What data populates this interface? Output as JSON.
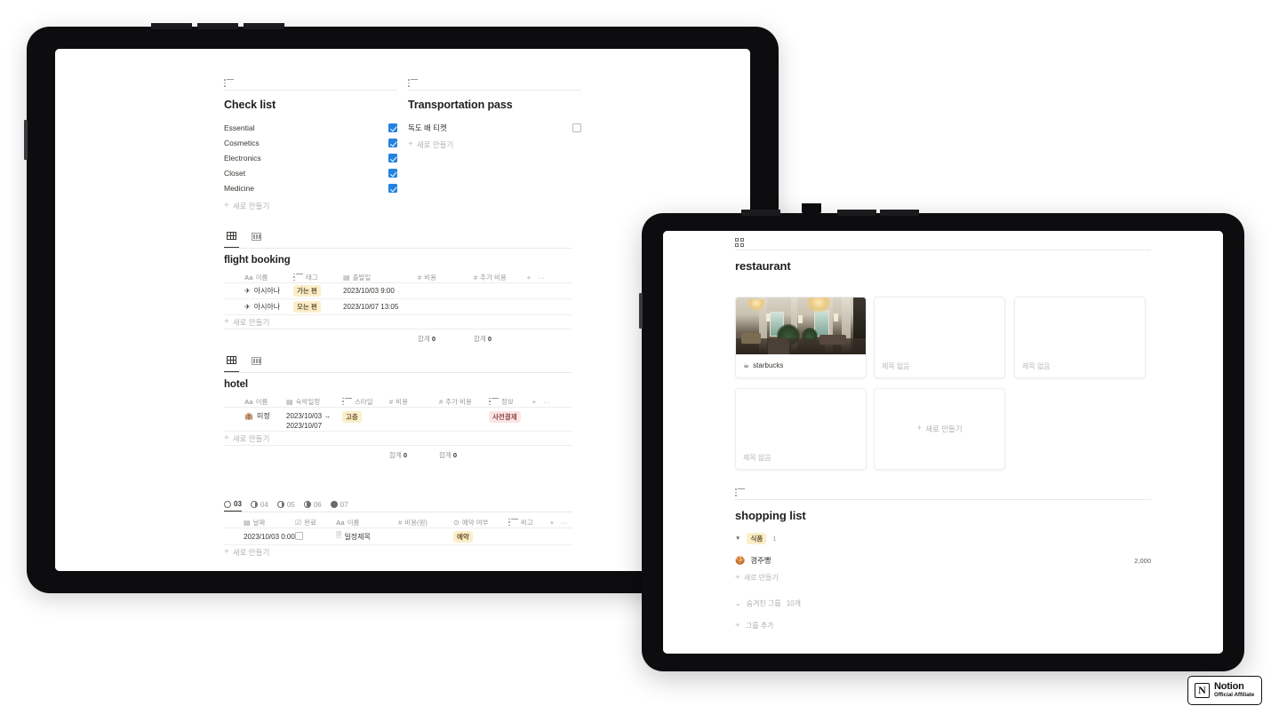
{
  "left_tablet": {
    "checklist": {
      "view_icon": "list-view-icon",
      "title": "Check list",
      "items": [
        {
          "label": "Essential",
          "checked": true
        },
        {
          "label": "Cosmetics",
          "checked": true
        },
        {
          "label": "Electronics",
          "checked": true
        },
        {
          "label": "Closet",
          "checked": true
        },
        {
          "label": "Medicine",
          "checked": true
        }
      ],
      "new_label": "새로 만들기"
    },
    "transportation": {
      "view_icon": "list-view-icon",
      "title": "Transportation pass",
      "items": [
        {
          "label": "독도 배 티켓",
          "checked": false
        }
      ],
      "new_label": "새로 만들기"
    },
    "flight_booking": {
      "tabs": [
        {
          "icon": "table-view-icon",
          "active": true
        },
        {
          "icon": "board-view-icon",
          "active": false
        }
      ],
      "title": "flight booking",
      "columns": [
        {
          "type": "Aa",
          "label": "이름"
        },
        {
          "type": "list",
          "label": "태그"
        },
        {
          "type": "date",
          "label": "출발일"
        },
        {
          "type": "#",
          "label": "비용"
        },
        {
          "type": "#",
          "label": "추가 비용"
        }
      ],
      "add_column": "+",
      "more": "···",
      "rows": [
        {
          "icon": "✈",
          "name": "아시아나",
          "tag": "가는 편",
          "tag_color": "#fbeeca",
          "date": "2023/10/03 9:00",
          "cost": "",
          "extra": ""
        },
        {
          "icon": "✈",
          "name": "아시아나",
          "tag": "오는 편",
          "tag_color": "#fbeeca",
          "date": "2023/10/07 13:05",
          "cost": "",
          "extra": ""
        }
      ],
      "new_label": "새로 만들기",
      "summaries": [
        {
          "label": "합계",
          "value": "0"
        },
        {
          "label": "합계",
          "value": "0"
        }
      ]
    },
    "hotel": {
      "tabs": [
        {
          "icon": "table-view-icon",
          "active": true
        },
        {
          "icon": "board-view-icon",
          "active": false
        }
      ],
      "title": "hotel",
      "columns": [
        {
          "type": "Aa",
          "label": "이름"
        },
        {
          "type": "date",
          "label": "숙박일정"
        },
        {
          "type": "list",
          "label": "스타일"
        },
        {
          "type": "#",
          "label": "비용"
        },
        {
          "type": "#",
          "label": "추가 비용"
        },
        {
          "type": "list",
          "label": "정보"
        }
      ],
      "add_column": "+",
      "more": "···",
      "rows": [
        {
          "icon": "🏨",
          "name": "미정",
          "date_line1": "2023/10/03 →",
          "date_line2": "2023/10/07",
          "style": "고층",
          "style_color": "#fbeeca",
          "cost": "",
          "extra": "",
          "info": "사전결제",
          "info_color": "#fbe4e4"
        }
      ],
      "new_label": "새로 만들기",
      "summaries": [
        {
          "label": "합계",
          "value": "0"
        },
        {
          "label": "합계",
          "value": "0"
        }
      ]
    },
    "schedule": {
      "day_tabs": [
        {
          "label": "03",
          "moon": "new",
          "active": true
        },
        {
          "label": "04",
          "moon": "waxing-crescent",
          "active": false
        },
        {
          "label": "05",
          "moon": "first-quarter",
          "active": false
        },
        {
          "label": "06",
          "moon": "waxing-gibbous",
          "active": false
        },
        {
          "label": "07",
          "moon": "full",
          "active": false
        }
      ],
      "columns": [
        {
          "type": "date",
          "label": "날짜"
        },
        {
          "type": "check",
          "label": "완료"
        },
        {
          "type": "Aa",
          "label": "이름"
        },
        {
          "type": "#",
          "label": "비용(원)"
        },
        {
          "type": "select",
          "label": "예약 여부"
        },
        {
          "type": "text",
          "label": "비고"
        }
      ],
      "add_column": "+",
      "more": "···",
      "rows": [
        {
          "date": "2023/10/03 0:00",
          "done": false,
          "name": "일정제목",
          "name_icon": "page-icon",
          "cost": "",
          "reserve": "예약",
          "reserve_color": "#fbeeca",
          "note": ""
        }
      ],
      "new_label": "새로 만들기"
    }
  },
  "right_tablet": {
    "restaurant": {
      "view_icon": "gallery-view-icon",
      "title": "restaurant",
      "cards": [
        {
          "title": "starbucks",
          "emoji": "☕",
          "has_image": true,
          "empty": false
        },
        {
          "title": "제목 없음",
          "emoji": "",
          "has_image": false,
          "empty": true
        },
        {
          "title": "제목 없음",
          "emoji": "",
          "has_image": false,
          "empty": true
        },
        {
          "title": "제목 없음",
          "emoji": "",
          "has_image": false,
          "empty": true
        }
      ],
      "add_card_label": "새로 만들기"
    },
    "shopping_list": {
      "view_icon": "list-view-icon",
      "title": "shopping list",
      "groups": [
        {
          "toggle": "▼",
          "name": "식품",
          "name_color": "#fbeeca",
          "count": "1",
          "items": [
            {
              "emoji": "🍪",
              "name": "경주빵",
              "value": "2,000"
            }
          ],
          "new_label": "새로 만들기"
        }
      ],
      "hidden_groups": {
        "toggle": "⌄",
        "label": "숨겨진 그룹",
        "count": "10개"
      },
      "add_group": {
        "plus": "+",
        "label": "그룹 추가"
      }
    }
  },
  "badge": {
    "logo_letter": "N",
    "line1": "Notion",
    "line2": "Official Affiliate"
  },
  "colors": {
    "accent_blue": "#2383e2",
    "tag_yellow": "#fbeeca",
    "tag_red": "#fbe4e4",
    "text": "#37352f",
    "muted": "#9b9a97",
    "divider": "#e9e9e7",
    "frame": "#0d0d0f"
  }
}
